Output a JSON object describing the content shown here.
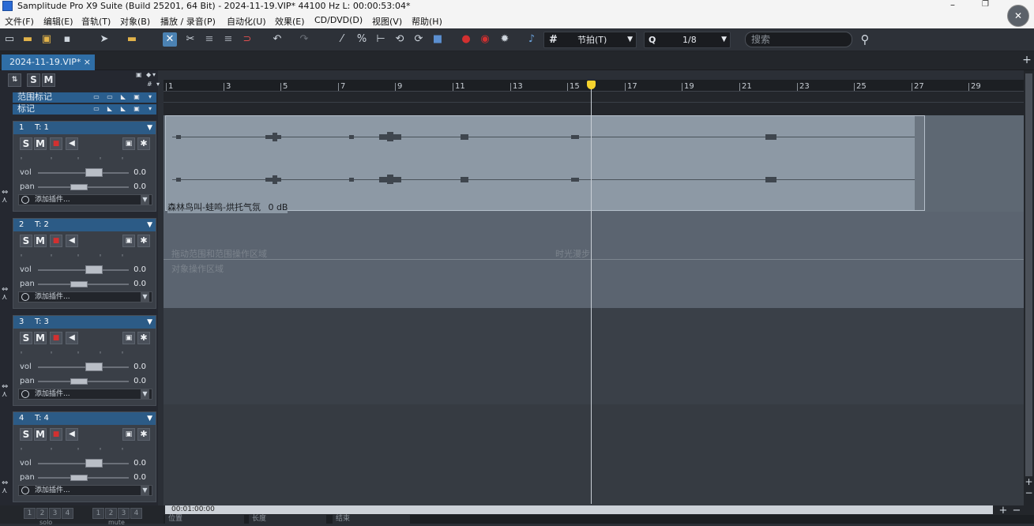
{
  "window": {
    "title": "Samplitude Pro X9 Suite (Build 25201, 64 Bit)  -  2024-11-19.VIP*   44100 Hz L: 00:00:53:04*",
    "minimize": "–",
    "restore": "❐",
    "close": "✕"
  },
  "menu": [
    "文件(F)",
    "编辑(E)",
    "音轨(T)",
    "对象(B)",
    "播放 / 录音(P)",
    "自动化(U)",
    "效果(E)",
    "CD/DVD(D)",
    "视图(V)",
    "帮助(H)"
  ],
  "toolbar": {
    "grid_mode": "节拍(T)",
    "quantize_label": "Q",
    "quantize_value": "1/8",
    "search_placeholder": "搜索",
    "grid_symbol": "#"
  },
  "tab": {
    "label": "2024-11-19.VIP*",
    "close": "×",
    "add": "+"
  },
  "global": {
    "solo": "S",
    "mute": "M"
  },
  "markers": {
    "range_label": "范围标记",
    "marker_label": "标记"
  },
  "ruler": [
    "1",
    "3",
    "5",
    "7",
    "9",
    "11",
    "13",
    "15",
    "17",
    "19",
    "21",
    "23",
    "25",
    "27",
    "29"
  ],
  "tracks": [
    {
      "num": "1",
      "name": "T: 1",
      "vol": "0.0",
      "pan": "0.0",
      "vol_pos": 0.62,
      "pan_pos": 0.45,
      "plugin": "添加插件..."
    },
    {
      "num": "2",
      "name": "T: 2",
      "vol": "0.0",
      "pan": "0.0",
      "vol_pos": 0.62,
      "pan_pos": 0.45,
      "plugin": "添加插件..."
    },
    {
      "num": "3",
      "name": "T: 3",
      "vol": "0.0",
      "pan": "0.0",
      "vol_pos": 0.62,
      "pan_pos": 0.45,
      "plugin": "添加插件..."
    },
    {
      "num": "4",
      "name": "T: 4",
      "vol": "0.0",
      "pan": "0.0",
      "vol_pos": 0.62,
      "pan_pos": 0.45,
      "plugin": "添加插件..."
    }
  ],
  "track_labels": {
    "vol": "vol",
    "pan": "pan",
    "solo": "S",
    "mute": "M"
  },
  "clip": {
    "name": "森林鸟叫-蛙鸣-烘托气氛",
    "gain": "0 dB"
  },
  "annotations": {
    "range_area": "拖动范围和范围操作区域",
    "object_area": "对象操作区域",
    "playhead_area": "时光漫步"
  },
  "bottom": {
    "position_time": "00:01:00:00",
    "banks_solo": [
      "1",
      "2",
      "3",
      "4"
    ],
    "banks_mute": [
      "1",
      "2",
      "3",
      "4"
    ],
    "solo_label": "solo",
    "mute_label": "mute",
    "status_position": "位置",
    "status_length": "长度",
    "status_end": "结束"
  },
  "colors": {
    "accent": "#2f6ea6",
    "clip": "#8d99a5",
    "playhead": "#f6d32d",
    "record": "#d23030"
  }
}
